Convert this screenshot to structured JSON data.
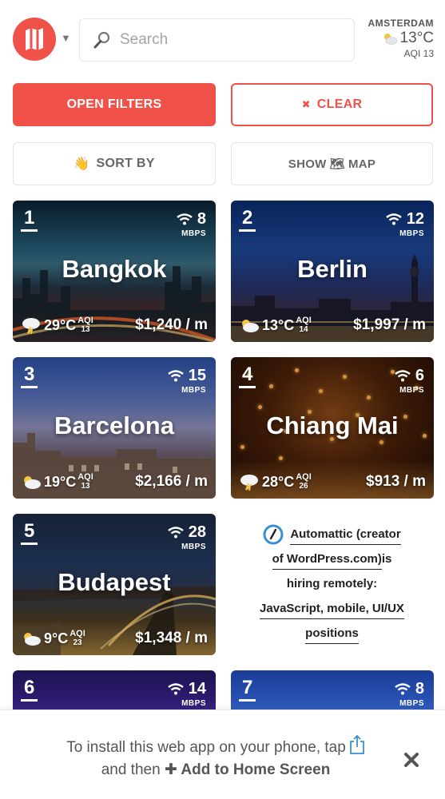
{
  "header": {
    "search_placeholder": "Search",
    "weather": {
      "city": "AMSTERDAM",
      "temp": "13°C",
      "aqi": "AQI 13"
    }
  },
  "buttons": {
    "open_filters": "OPEN FILTERS",
    "clear": "CLEAR",
    "clear_glyph": "✖",
    "sort": "SORT BY",
    "sort_glyph": "👋",
    "show": "SHOW",
    "map_glyph": "🗺",
    "map": "MAP"
  },
  "cities": [
    {
      "rank": "1",
      "name": "Bangkok",
      "speed": "8",
      "speed_unit": "MBPS",
      "temp": "29°C",
      "aqi_label": "AQI",
      "aqi": "13",
      "cost": "$1,240 / m",
      "weather": "thunder-icon"
    },
    {
      "rank": "2",
      "name": "Berlin",
      "speed": "12",
      "speed_unit": "MBPS",
      "temp": "13°C",
      "aqi_label": "AQI",
      "aqi": "14",
      "cost": "$1,997 / m",
      "weather": "cloud-icon"
    },
    {
      "rank": "3",
      "name": "Barcelona",
      "speed": "15",
      "speed_unit": "MBPS",
      "temp": "19°C",
      "aqi_label": "AQI",
      "aqi": "13",
      "cost": "$2,166 / m",
      "weather": "cloud-icon"
    },
    {
      "rank": "4",
      "name": "Chiang Mai",
      "speed": "6",
      "speed_unit": "MBPS",
      "temp": "28°C",
      "aqi_label": "AQI",
      "aqi": "26",
      "cost": "$913 / m",
      "weather": "thunder-icon"
    },
    {
      "rank": "5",
      "name": "Budapest",
      "speed": "28",
      "speed_unit": "MBPS",
      "temp": "9°C",
      "aqi_label": "AQI",
      "aqi": "23",
      "cost": "$1,348 / m",
      "weather": "cloud-icon"
    },
    {
      "rank": "6",
      "speed": "14",
      "speed_unit": "MBPS"
    },
    {
      "rank": "7",
      "speed": "8",
      "speed_unit": "MBPS"
    }
  ],
  "sponsor": {
    "line1": "Automattic (creator",
    "line2": "of WordPress.com)",
    "line2_tail": " is",
    "line3": "hiring remotely:",
    "line4": "JavaScript, mobile, UI/UX",
    "line5": "positions"
  },
  "banner": {
    "text1": "To install this web app on your phone, tap",
    "text2": "and then ",
    "text2_bold": "✚ Add to Home Screen"
  },
  "colors": {
    "brand": "#f0524a"
  }
}
